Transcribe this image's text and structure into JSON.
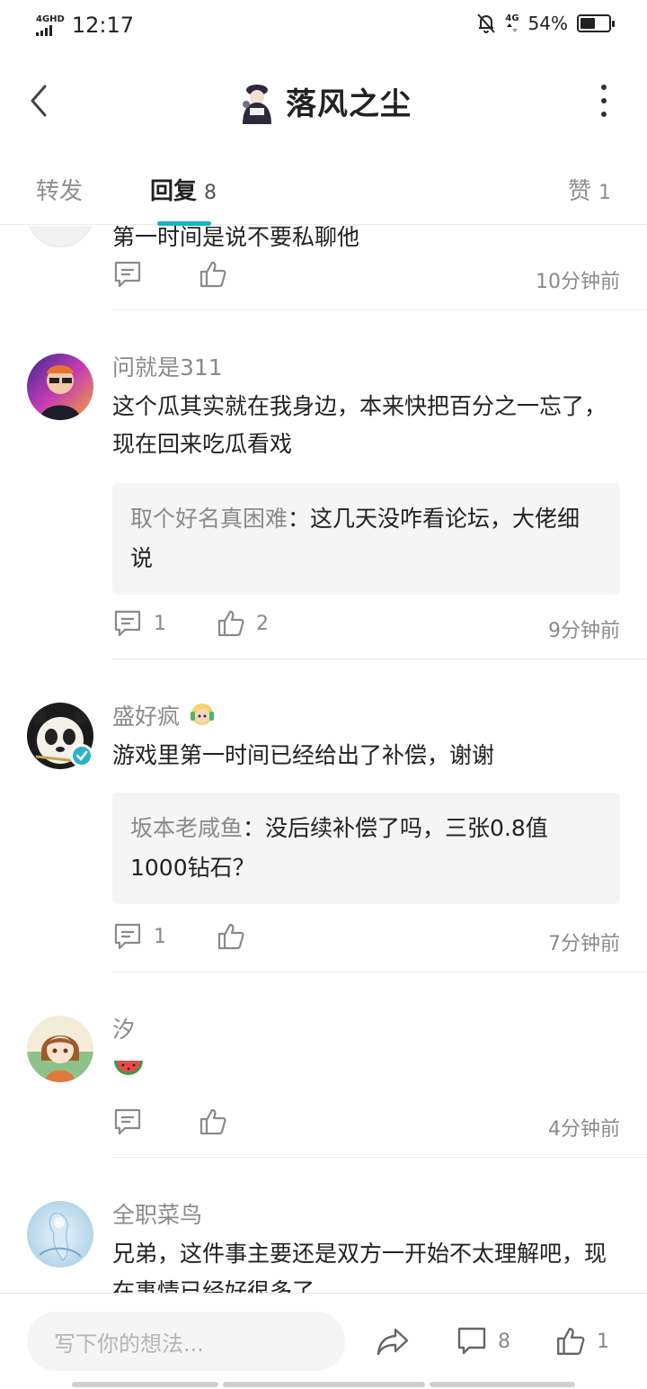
{
  "status_bar": {
    "network_left": "4GHD",
    "time": "12:17",
    "network_right": "4G",
    "battery_percent_label": "54%",
    "battery_level": 0.54
  },
  "header": {
    "title": "落风之尘"
  },
  "tabs": [
    {
      "label": "转发",
      "count": ""
    },
    {
      "label": "回复",
      "count": "8"
    },
    {
      "label": "赞",
      "count": "1"
    }
  ],
  "partial_comment": {
    "text": "第一时间是说不要私聊他",
    "reply_count": "",
    "like_count": "",
    "time": "10分钟前"
  },
  "comments": [
    {
      "username": "问就是311",
      "text": "这个瓜其实就在我身边，本来快把百分之一忘了，现在回来吃瓜看戏",
      "quote_name": "取个好名真困难",
      "quote_sep": "：",
      "quote_text": "这几天没咋看论坛，大佬细说",
      "reply_count": "1",
      "like_count": "2",
      "time": "9分钟前"
    },
    {
      "username": "盛好疯",
      "text": "游戏里第一时间已经给出了补偿，谢谢",
      "quote_name": "坂本老咸鱼",
      "quote_sep": "：",
      "quote_text": "没后续补偿了吗，三张0.8值1000钻石？",
      "reply_count": "1",
      "like_count": "",
      "time": "7分钟前"
    },
    {
      "username": "汐",
      "text": "",
      "emoji": "watermelon-icon",
      "reply_count": "",
      "like_count": "",
      "time": "4分钟前"
    },
    {
      "username": "全职菜鸟",
      "text": "兄弟，这件事主要还是双方一开始不太理解吧，现在事情已经好很多了"
    }
  ],
  "bottom_bar": {
    "input_placeholder": "写下你的想法...",
    "comment_count": "8",
    "like_count": "1"
  },
  "colors": {
    "accent": "#17b3c7",
    "muted_text": "#8a8a8a",
    "quote_bg": "#f5f5f5"
  }
}
